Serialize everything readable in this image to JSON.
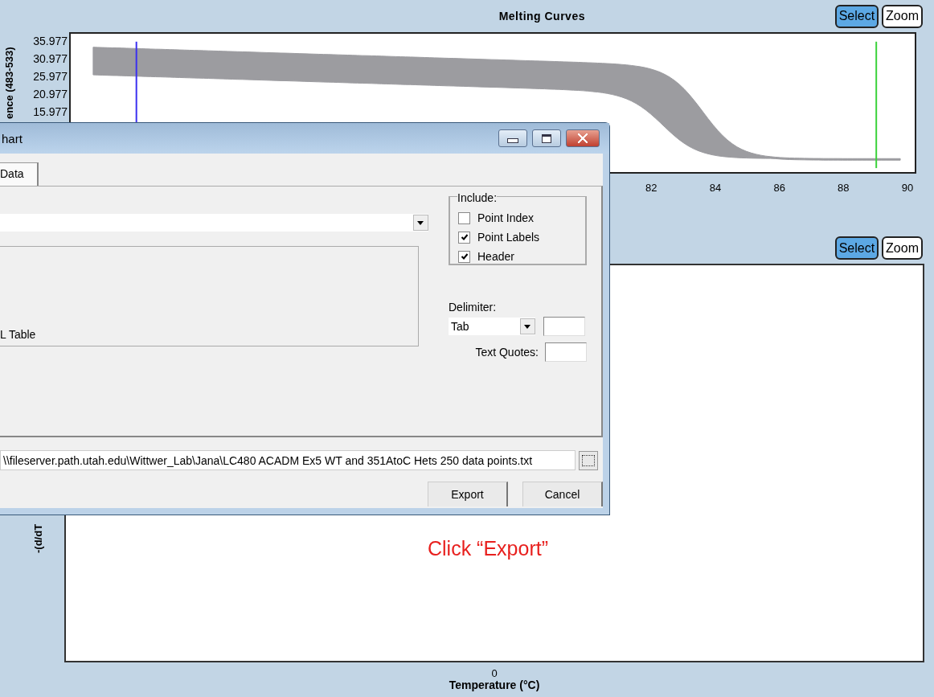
{
  "top_chart": {
    "title": "Melting Curves",
    "buttons": [
      {
        "label": "Select",
        "selected": true
      },
      {
        "label": "Zoom",
        "selected": false
      }
    ],
    "ylabel": "ence (483-533)",
    "yticks": [
      "35.977",
      "30.977",
      "25.977",
      "20.977",
      "15.977"
    ],
    "xticks": [
      "82",
      "84",
      "86",
      "88",
      "90"
    ]
  },
  "bottom_chart": {
    "buttons": [
      {
        "label": "Select",
        "selected": true
      },
      {
        "label": "Zoom",
        "selected": false
      }
    ],
    "ylabel": "-(d/dT",
    "xticks": [
      "0"
    ],
    "xlabel": "Temperature (°C)"
  },
  "annotation": "Click “Export”",
  "dialog": {
    "title": "hart",
    "tabs": [
      {
        "label": "Data",
        "selected": true
      }
    ],
    "format_item": "L Table",
    "include": {
      "legend": "Include:",
      "options": [
        {
          "label": "Point Index",
          "checked": false
        },
        {
          "label": "Point Labels",
          "checked": true
        },
        {
          "label": "Header",
          "checked": true
        }
      ]
    },
    "delimiter": {
      "label": "Delimiter:",
      "value": "Tab"
    },
    "text_quotes": {
      "label": "Text Quotes:"
    },
    "file_path": "\\\\fileserver.path.utah.edu\\Wittwer_Lab\\Jana\\LC480 ACADM Ex5 WT and 351AtoC Hets 250 data points.txt",
    "buttons": [
      "Export",
      "Cancel"
    ]
  }
}
